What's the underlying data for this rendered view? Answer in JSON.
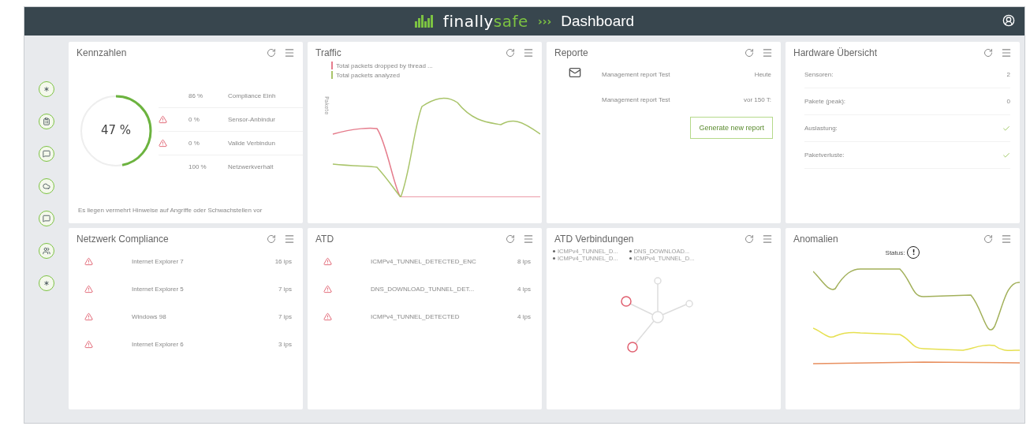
{
  "header": {
    "logo_first": "finally",
    "logo_second": "safe",
    "separator": "›››",
    "title": "Dashboard"
  },
  "sidebar": {
    "items": [
      {
        "kind": "asterisk"
      },
      {
        "kind": "clipboard"
      },
      {
        "kind": "chat"
      },
      {
        "kind": "cloud"
      },
      {
        "kind": "chat"
      },
      {
        "kind": "users"
      },
      {
        "kind": "asterisk"
      }
    ]
  },
  "kennzahlen": {
    "title": "Kennzahlen",
    "gauge": {
      "label": "47 %",
      "level": 0.47
    },
    "rows": [
      {
        "warning": false,
        "value": "86 %",
        "label": "Compliance Einh"
      },
      {
        "warning": true,
        "value": "0 %",
        "label": "Sensor-Anbindur"
      },
      {
        "warning": true,
        "value": "0 %",
        "label": "Valide Verbindun"
      },
      {
        "warning": false,
        "value": "100 %",
        "label": "Netzwerkverhalt"
      }
    ],
    "footer": "Es liegen vermehrt Hinweise auf Angriffe oder Schwachstellen vor"
  },
  "traffic": {
    "title": "Traffic",
    "ylabel": "Pakete",
    "legend": [
      {
        "label": "Total packets dropped by thread ...",
        "color": "#e57c8c"
      },
      {
        "label": "Total packets analyzed",
        "color": "#a9c46a"
      }
    ]
  },
  "reporte": {
    "title": "Reporte",
    "rows": [
      {
        "has_icon": true,
        "name": "Management report Test",
        "date": "Heute"
      },
      {
        "has_icon": false,
        "name": "Management report Test",
        "date": "vor 150 T:"
      }
    ],
    "button": "Generate new report"
  },
  "hardware": {
    "title": "Hardware Übersicht",
    "rows": [
      {
        "label": "Sensoren:",
        "kind": "text",
        "value": "2"
      },
      {
        "label": "Pakete (peak):",
        "kind": "text",
        "value": "0"
      },
      {
        "label": "Auslastung:",
        "kind": "check"
      },
      {
        "label": "Paketverluste:",
        "kind": "check"
      }
    ]
  },
  "compliance": {
    "title": "Netzwerk Compliance",
    "rows": [
      {
        "name": "Internet Explorer 7",
        "count": "16 ips"
      },
      {
        "name": "Internet Explorer 5",
        "count": "7 ips"
      },
      {
        "name": "Windows 98",
        "count": "7 ips"
      },
      {
        "name": "Internet Explorer 6",
        "count": "3 ips"
      }
    ]
  },
  "atd": {
    "title": "ATD",
    "rows": [
      {
        "name": "ICMPv4_TUNNEL_DETECTED_ENC",
        "count": "8 ips"
      },
      {
        "name": "DNS_DOWNLOAD_TUNNEL_DET...",
        "count": "4 ips"
      },
      {
        "name": "ICMPv4_TUNNEL_DETECTED",
        "count": "4 ips"
      }
    ]
  },
  "atd_verbindungen": {
    "title": "ATD Verbindungen",
    "legend": [
      "ICMPv4_TUNNEL_D...",
      "DNS_DOWNLOAD...",
      "ICMPv4_TUNNEL_D...",
      "ICMPv4_TUNNEL_D..."
    ]
  },
  "anomalien": {
    "title": "Anomalien",
    "status_label": "Status:",
    "status_symbol": "!"
  }
}
